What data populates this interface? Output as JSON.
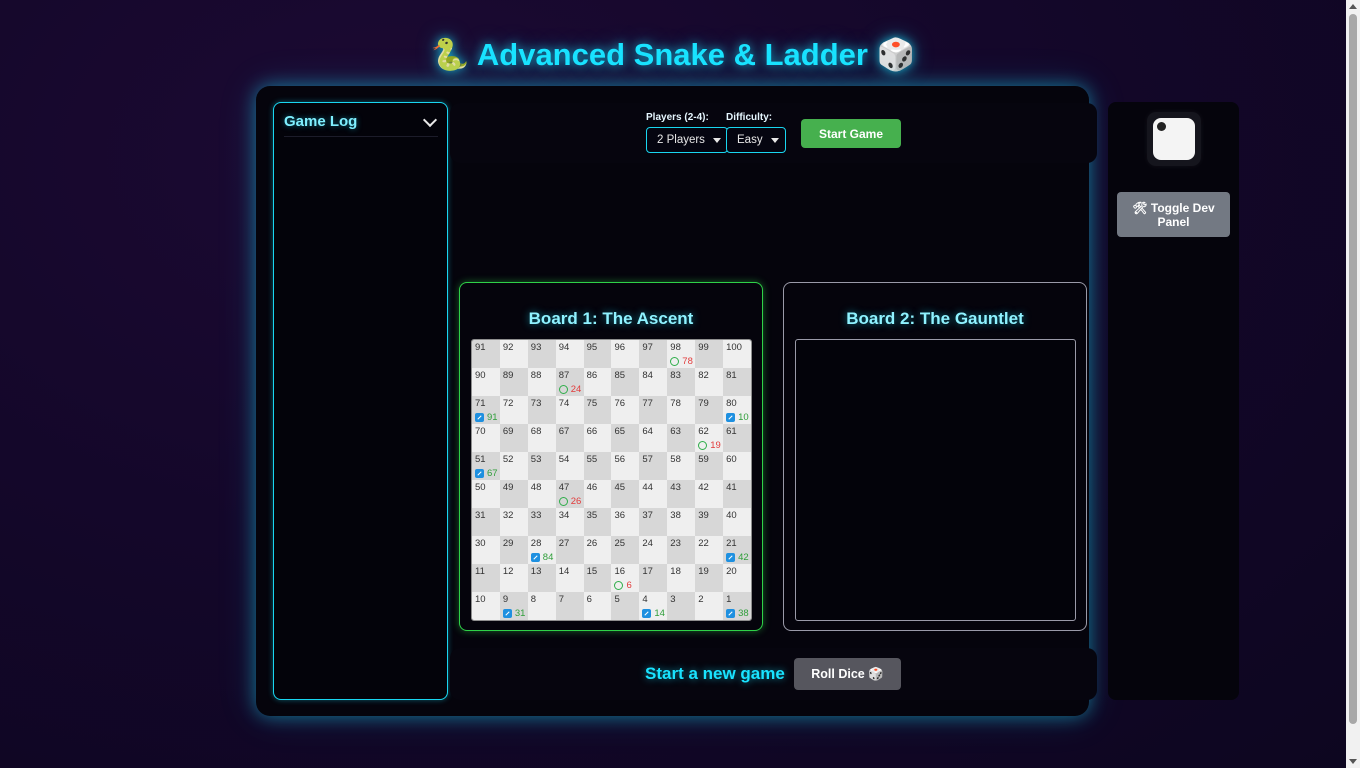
{
  "header": {
    "title": "🐍 Advanced Snake & Ladder 🎲"
  },
  "game_log": {
    "title": "Game Log",
    "entries": []
  },
  "controls": {
    "players_label": "Players (2-4):",
    "players_value": "2 Players",
    "difficulty_label": "Difficulty:",
    "difficulty_value": "Easy",
    "start_label": "Start Game"
  },
  "boards": [
    {
      "title": "Board 1: The Ascent",
      "rows": [
        [
          91,
          92,
          93,
          94,
          95,
          96,
          97,
          98,
          99,
          100
        ],
        [
          90,
          89,
          88,
          87,
          86,
          85,
          84,
          83,
          82,
          81
        ],
        [
          71,
          72,
          73,
          74,
          75,
          76,
          77,
          78,
          79,
          80
        ],
        [
          70,
          69,
          68,
          67,
          66,
          65,
          64,
          63,
          62,
          61
        ],
        [
          51,
          52,
          53,
          54,
          55,
          56,
          57,
          58,
          59,
          60
        ],
        [
          50,
          49,
          48,
          47,
          46,
          45,
          44,
          43,
          42,
          41
        ],
        [
          31,
          32,
          33,
          34,
          35,
          36,
          37,
          38,
          39,
          40
        ],
        [
          30,
          29,
          28,
          27,
          26,
          25,
          24,
          23,
          22,
          21
        ],
        [
          11,
          12,
          13,
          14,
          15,
          16,
          17,
          18,
          19,
          20
        ],
        [
          10,
          9,
          8,
          7,
          6,
          5,
          4,
          3,
          2,
          1
        ]
      ],
      "snakes": {
        "98": "78",
        "87": "24",
        "62": "19",
        "47": "26",
        "16": "6"
      },
      "ladders": {
        "71": "91",
        "80": "10",
        "51": "67",
        "28": "84",
        "21": "42",
        "9": "31",
        "4": "14",
        "1": "38"
      }
    },
    {
      "title": "Board 2: The Gauntlet"
    }
  ],
  "status": {
    "message": "Start a new game",
    "roll_label": "Roll Dice 🎲"
  },
  "side": {
    "dev_toggle_label": "🛠 Toggle Dev Panel",
    "dice_value": 1
  },
  "colors": {
    "accent": "#19e3ff",
    "board1_border": "#2fd148",
    "start_button": "#46b04e",
    "snake_text": "#e23b3b",
    "ladder_text": "#2f9e3a"
  }
}
